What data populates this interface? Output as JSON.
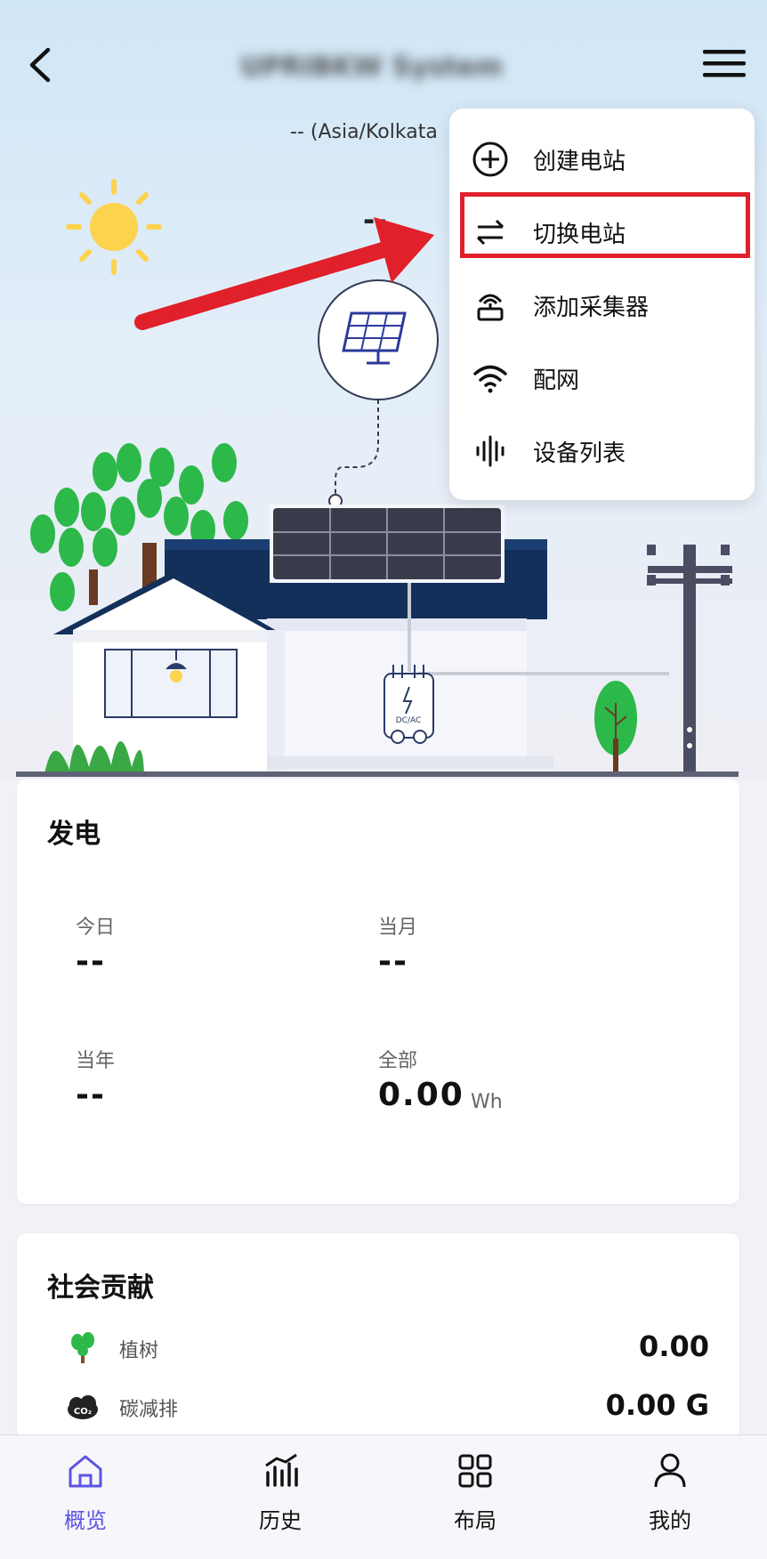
{
  "header": {
    "station_name": "UPRIBKW System",
    "timezone": "-- (Asia/Kolkata",
    "current_power": "--"
  },
  "menu": {
    "items": [
      {
        "label": "创建电站",
        "icon": "plus-circle-icon"
      },
      {
        "label": "切换电站",
        "icon": "swap-arrows-icon"
      },
      {
        "label": "添加采集器",
        "icon": "router-icon"
      },
      {
        "label": "配网",
        "icon": "wifi-icon"
      },
      {
        "label": "设备列表",
        "icon": "waveform-icon"
      }
    ],
    "highlighted_item": "切换电站"
  },
  "scene": {
    "inverter_label": "DC/AC"
  },
  "generation": {
    "title": "发电",
    "today_label": "今日",
    "today_value": "--",
    "month_label": "当月",
    "month_value": "--",
    "year_label": "当年",
    "year_value": "--",
    "total_label": "全部",
    "total_value": "0.00",
    "total_unit": "Wh"
  },
  "social": {
    "title": "社会贡献",
    "rows": [
      {
        "label": "植树",
        "value": "0.00",
        "icon": "tree-icon"
      },
      {
        "label": "碳减排",
        "value": "0.00 G",
        "icon": "co2-icon"
      }
    ],
    "co2_text": "CO₂"
  },
  "tabs": [
    {
      "label": "概览",
      "icon": "home-icon",
      "active": true
    },
    {
      "label": "历史",
      "icon": "bar-chart-icon",
      "active": false
    },
    {
      "label": "布局",
      "icon": "grid-icon",
      "active": false
    },
    {
      "label": "我的",
      "icon": "person-icon",
      "active": false
    }
  ],
  "colors": {
    "accent": "#5b55e0",
    "highlight": "#e0202a",
    "roof": "#12305a",
    "leaf": "#2db84a"
  }
}
